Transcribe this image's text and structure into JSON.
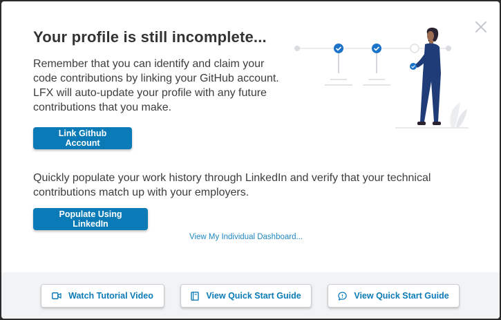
{
  "modal": {
    "title": "Your profile is still incomplete...",
    "paragraph_github": "Remember that you can identify and claim your code contributions by linking your GitHub account. LFX will auto-update your profile with any future contributions that you make.",
    "link_github_label": "Link Github Account",
    "paragraph_linkedin": "Quickly populate your work history through LinkedIn and verify that your technical contributions match up with your employers.",
    "populate_linkedin_label": "Populate Using LinkedIn",
    "dashboard_link": "View My Individual Dashboard..."
  },
  "footer": {
    "buttons": [
      {
        "label": "Watch Tutorial Video",
        "icon": "video-camera-icon"
      },
      {
        "label": "View Quick Start Guide",
        "icon": "book-icon"
      },
      {
        "label": "View Quick Start Guide",
        "icon": "chat-bubble-icon"
      }
    ]
  },
  "colors": {
    "primary": "#0a7bb7",
    "link": "#1f87c3",
    "footer_bg": "#f2f3f4",
    "illustration_navy": "#1f3b78"
  }
}
